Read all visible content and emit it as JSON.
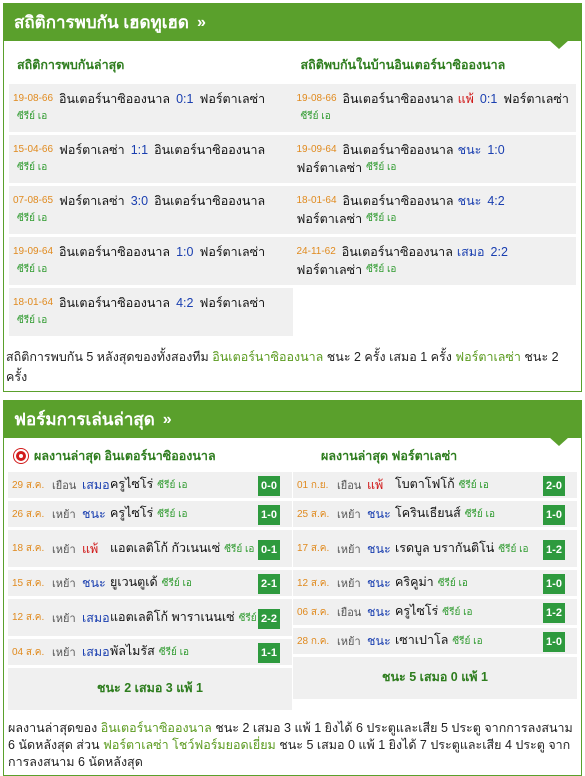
{
  "h2h": {
    "header_title": "สถิติการพบกัน เฮดทูเฮด",
    "header_chevron": "»",
    "left_title": "สถิติการพบกันล่าสุด",
    "right_title": "สถิติพบกันในบ้านอินเตอร์นาซิอองนาล",
    "left_rows": [
      {
        "date": "19-08-66",
        "home": "อินเตอร์นาซิอองนาล",
        "score": "0:1",
        "away": "ฟอร์ตาเลซ่า",
        "league": "ซีรีย์ เอ"
      },
      {
        "date": "15-04-66",
        "home": "ฟอร์ตาเลซ่า",
        "score": "1:1",
        "away": "อินเตอร์นาซิอองนาล",
        "league": "ซีรีย์ เอ"
      },
      {
        "date": "07-08-65",
        "home": "ฟอร์ตาเลซ่า",
        "score": "3:0",
        "away": "อินเตอร์นาซิอองนาล",
        "league": "ซีรีย์ เอ"
      },
      {
        "date": "19-09-64",
        "home": "อินเตอร์นาซิอองนาล",
        "score": "1:0",
        "away": "ฟอร์ตาเลซ่า",
        "league": "ซีรีย์ เอ"
      },
      {
        "date": "18-01-64",
        "home": "อินเตอร์นาซิอองนาล",
        "score": "4:2",
        "away": "ฟอร์ตาเลซ่า",
        "league": "ซีรีย์ เอ"
      }
    ],
    "right_rows": [
      {
        "date": "19-08-66",
        "home": "อินเตอร์นาซิอองนาล",
        "result": "แพ้",
        "result_type": "lose",
        "score": "0:1",
        "away": "ฟอร์ตาเลซ่า",
        "league": "ซีรีย์ เอ"
      },
      {
        "date": "19-09-64",
        "home": "อินเตอร์นาซิอองนาล",
        "result": "ชนะ",
        "result_type": "win",
        "score": "1:0",
        "away": "ฟอร์ตาเลซ่า",
        "league": "ซีรีย์ เอ"
      },
      {
        "date": "18-01-64",
        "home": "อินเตอร์นาซิอองนาล",
        "result": "ชนะ",
        "result_type": "win",
        "score": "4:2",
        "away": "ฟอร์ตาเลซ่า",
        "league": "ซีรีย์ เอ"
      },
      {
        "date": "24-11-62",
        "home": "อินเตอร์นาซิอองนาล",
        "result": "เสมอ",
        "result_type": "draw",
        "score": "2:2",
        "away": "ฟอร์ตาเลซ่า",
        "league": "ซีรีย์ เอ"
      }
    ],
    "summary_pre": "สถิติการพบกัน 5 หลังสุดของทั้งสองทีม ",
    "summary_team1": "อินเตอร์นาซิอองนาล",
    "summary_mid": " ชนะ 2 ครั้ง เสมอ 1 ครั้ง ",
    "summary_team2": "ฟอร์ตาเลซ่า",
    "summary_post": " ชนะ 2 ครั้ง"
  },
  "form": {
    "header_title": "ฟอร์มการเล่นล่าสุด",
    "header_chevron": "»",
    "left_title": "ผลงานล่าสุด อินเตอร์นาซิอองนาล",
    "right_title": "ผลงานล่าสุด ฟอร์ตาเลซ่า",
    "left_rows": [
      {
        "date": "29 ส.ค.",
        "venue": "เยือน",
        "result": "เสมอ",
        "result_type": "draw",
        "opponent": "ครูไซโร่",
        "league": "ซีรีย์ เอ",
        "score": "0-0"
      },
      {
        "date": "26 ส.ค.",
        "venue": "เหย้า",
        "result": "ชนะ",
        "result_type": "win",
        "opponent": "ครูไซโร่",
        "league": "ซีรีย์ เอ",
        "score": "1-0"
      },
      {
        "date": "18 ส.ค.",
        "venue": "เหย้า",
        "result": "แพ้",
        "result_type": "lose",
        "opponent": "แอตเลติโก้ กัวเนนเซ่",
        "league": "ซีรีย์ เอ",
        "score": "0-1"
      },
      {
        "date": "15 ส.ค.",
        "venue": "เหย้า",
        "result": "ชนะ",
        "result_type": "win",
        "opponent": "ยูเวนตูเด้",
        "league": "ซีรีย์ เอ",
        "score": "2-1"
      },
      {
        "date": "12 ส.ค.",
        "venue": "เหย้า",
        "result": "เสมอ",
        "result_type": "draw",
        "opponent": "แอตเลติโก้ พาราเนนเซ่",
        "league": "ซีรีย์ เอ",
        "score": "2-2"
      },
      {
        "date": "04 ส.ค.",
        "venue": "เหย้า",
        "result": "เสมอ",
        "result_type": "draw",
        "opponent": "พัลไมรัส",
        "league": "ซีรีย์ เอ",
        "score": "1-1"
      }
    ],
    "right_rows": [
      {
        "date": "01 ก.ย.",
        "venue": "เยือน",
        "result": "แพ้",
        "result_type": "lose",
        "opponent": "โบตาโฟโก้",
        "league": "ซีรีย์ เอ",
        "score": "2-0"
      },
      {
        "date": "25 ส.ค.",
        "venue": "เหย้า",
        "result": "ชนะ",
        "result_type": "win",
        "opponent": "โครินเธียนส์",
        "league": "ซีรีย์ เอ",
        "score": "1-0"
      },
      {
        "date": "17 ส.ค.",
        "venue": "เหย้า",
        "result": "ชนะ",
        "result_type": "win",
        "opponent": "เรดบูล บรากันติโน่",
        "league": "ซีรีย์ เอ",
        "score": "1-2"
      },
      {
        "date": "12 ส.ค.",
        "venue": "เหย้า",
        "result": "ชนะ",
        "result_type": "win",
        "opponent": "คริคูม่า",
        "league": "ซีรีย์ เอ",
        "score": "1-0"
      },
      {
        "date": "06 ส.ค.",
        "venue": "เยือน",
        "result": "ชนะ",
        "result_type": "win",
        "opponent": "ครูไซโร่",
        "league": "ซีรีย์ เอ",
        "score": "1-2"
      },
      {
        "date": "28 ก.ค.",
        "venue": "เหย้า",
        "result": "ชนะ",
        "result_type": "win",
        "opponent": "เซาเปาโล",
        "league": "ซีรีย์ เอ",
        "score": "1-0"
      }
    ],
    "left_summary": "ชนะ 2 เสมอ 3 แพ้ 1",
    "right_summary": "ชนะ 5 เสมอ 0 แพ้ 1",
    "summary_pre": "ผลงานล่าสุดของ ",
    "summary_team1": "อินเตอร์นาซิอองนาล",
    "summary_mid1": " ชนะ 2 เสมอ 3 แพ้ 1 ยิงได้ 6 ประตูและเสีย 5 ประตู จากการลงสนาม 6 นัดหลังสุด ส่วน ",
    "summary_team2": "ฟอร์ตาเลซ่า",
    "summary_mid2": " ",
    "summary_hl": "โชว์ฟอร์มยอดเยี่ยม",
    "summary_post": " ชนะ 5 เสมอ 0 แพ้ 1 ยิงได้ 7 ประตูและเสีย 4 ประตู จากการลงสนาม 6 นัดหลังสุด"
  },
  "colors": {
    "brand": "#5aa02c",
    "date": "#e08a1e",
    "score": "#1a3fb0",
    "lose": "#d01818",
    "badge": "#2e9a3e"
  }
}
